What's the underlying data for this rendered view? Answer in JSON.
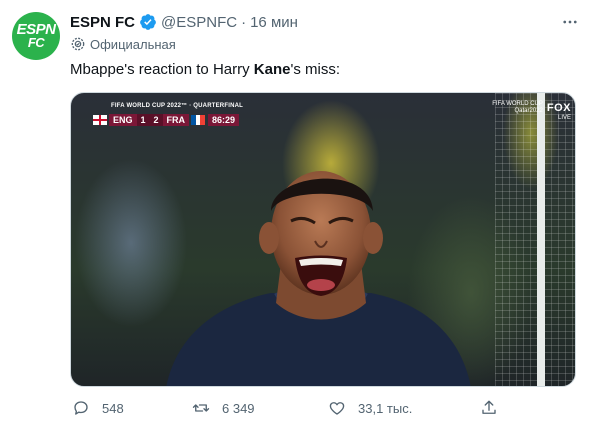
{
  "account": {
    "avatar_text_top": "ESPN",
    "avatar_text_bottom": "FC",
    "avatar_color": "#2bb24c",
    "name": "ESPN FC",
    "verified_icon": "verified-badge-icon",
    "handle": "@ESPNFC",
    "separator": "·",
    "time": "16 мин",
    "badge": "Официальная"
  },
  "tweet": {
    "text_before": "Mbappe's reaction to Harry ",
    "text_bold": "Kane",
    "text_after": "'s miss:"
  },
  "media": {
    "scorebug": {
      "competition": "FIFA WORLD CUP 2022™ · QUARTERFINAL",
      "team1": "ENG",
      "score1": "1",
      "score2": "2",
      "team2": "FRA",
      "clock": "86:29"
    },
    "broadcaster": {
      "competition": "FIFA WORLD CUP",
      "edition": "Qatar2022",
      "network": "FOX",
      "live": "LIVE"
    }
  },
  "actions": {
    "reply_count": "548",
    "retweet_count": "6 349",
    "like_count": "33,1 тыс.",
    "share_icon": "share-icon"
  }
}
